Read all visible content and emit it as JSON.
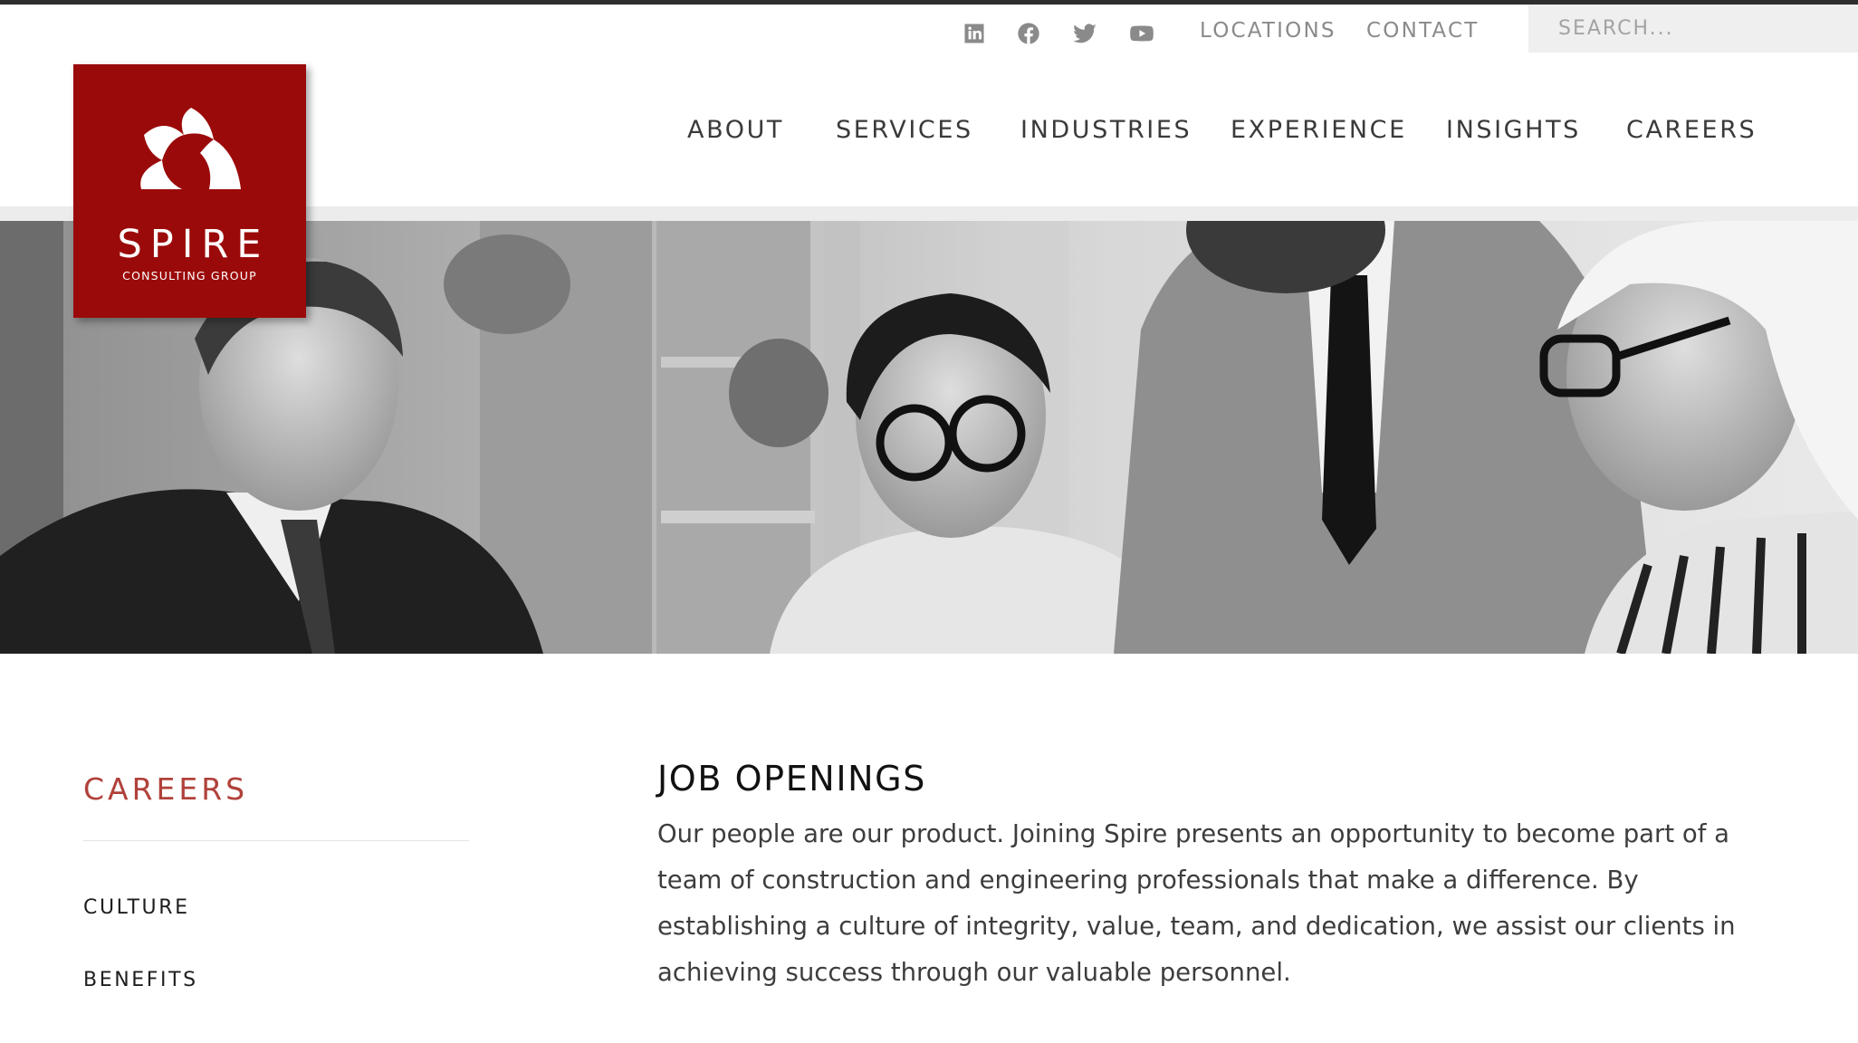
{
  "utility": {
    "social": [
      {
        "icon": "linkedin-icon"
      },
      {
        "icon": "facebook-icon"
      },
      {
        "icon": "twitter-icon"
      },
      {
        "icon": "youtube-icon"
      }
    ],
    "links": [
      "LOCATIONS",
      "CONTACT"
    ],
    "search_placeholder": "SEARCH..."
  },
  "logo": {
    "name": "SPIRE",
    "tagline": "CONSULTING GROUP",
    "color": "#9b0a0a"
  },
  "nav": {
    "items": [
      "ABOUT",
      "SERVICES",
      "INDUSTRIES",
      "EXPERIENCE",
      "INSIGHTS",
      "CAREERS"
    ]
  },
  "sidebar": {
    "title": "CAREERS",
    "title_color": "#b0413a",
    "items": [
      "CULTURE",
      "BENEFITS"
    ]
  },
  "content": {
    "title": "JOB OPENINGS",
    "body": "Our people are our product. Joining Spire presents an opportunity to become part of a team of construction and engineering professionals that make a difference. By establishing a culture of integrity, value, team, and dedication, we assist our clients in achieving success through our valuable personnel."
  }
}
